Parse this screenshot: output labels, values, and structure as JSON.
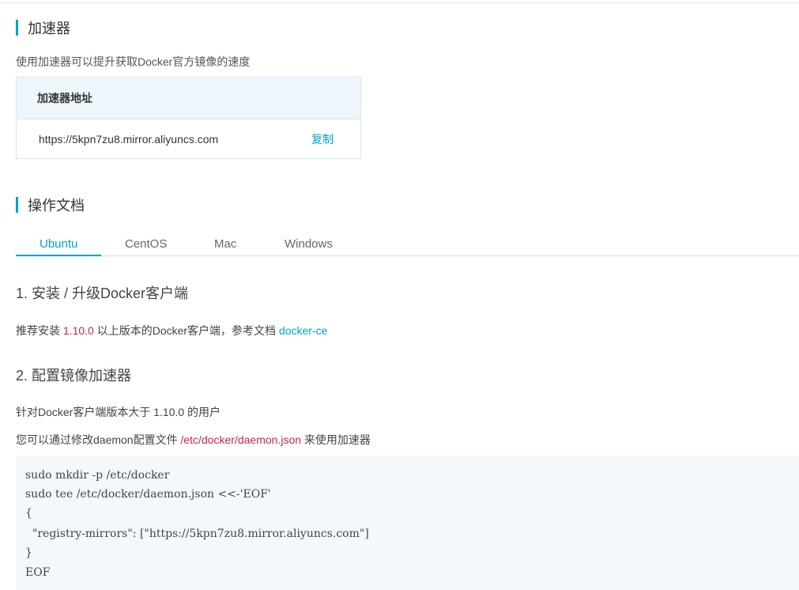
{
  "accelerator": {
    "title": "加速器",
    "description": "使用加速器可以提升获取Docker官方镜像的速度",
    "table_header": "加速器地址",
    "address": "https://5kpn7zu8.mirror.aliyuncs.com",
    "copy_label": "复制"
  },
  "docs": {
    "title": "操作文档",
    "tabs": [
      {
        "label": "Ubuntu",
        "active": true
      },
      {
        "label": "CentOS",
        "active": false
      },
      {
        "label": "Mac",
        "active": false
      },
      {
        "label": "Windows",
        "active": false
      }
    ]
  },
  "step1": {
    "heading": "1. 安装 / 升级Docker客户端",
    "text_before": "推荐安装 ",
    "version": "1.10.0",
    "text_middle": " 以上版本的Docker客户端，参考文档 ",
    "link": "docker-ce"
  },
  "step2": {
    "heading": "2. 配置镜像加速器",
    "line1": "针对Docker客户端版本大于 1.10.0 的用户",
    "line2_before": "您可以通过修改daemon配置文件 ",
    "config_path": "/etc/docker/daemon.json",
    "line2_after": " 来使用加速器"
  },
  "code_lines": [
    "sudo mkdir -p /etc/docker",
    "sudo tee /etc/docker/daemon.json <<-'EOF'",
    "{",
    "  \"registry-mirrors\": [\"https://5kpn7zu8.mirror.aliyuncs.com\"]",
    "}",
    "EOF"
  ],
  "colors": {
    "accent": "#00a2ca",
    "highlight": "#c7254e",
    "code_bg": "#f4f8fc"
  }
}
